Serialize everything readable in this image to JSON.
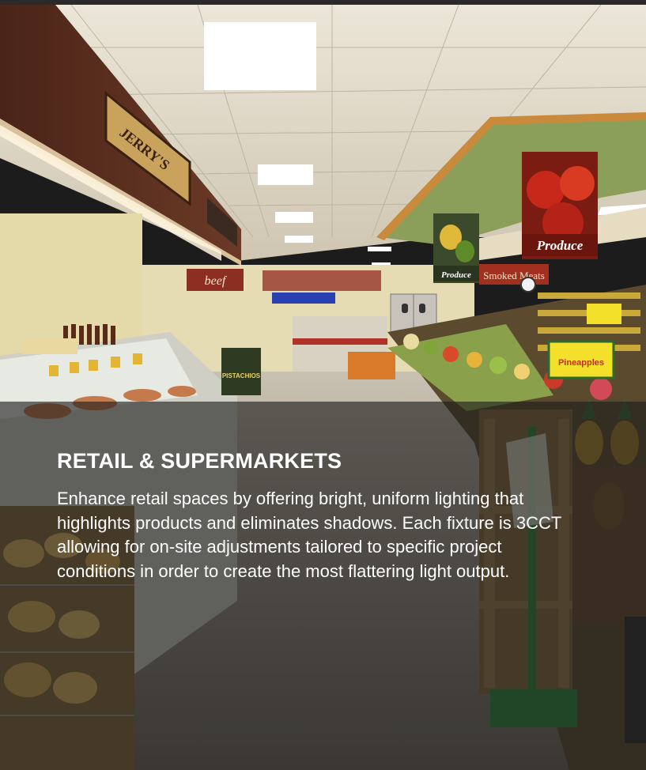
{
  "card": {
    "title": "RETAIL & SUPERMARKETS",
    "description": "Enhance retail spaces by offering bright, uniform lighting that highlights products and eliminates shadows. Each fixture is 3CCT allowing for on-site adjustments tailored to specific project conditions in order to create the most flattering light output."
  },
  "scene_signs": {
    "deli": "JERRY'S",
    "beef": "beef",
    "produce_banner_1": "Produce",
    "produce_banner_2": "Produce",
    "smoked_meats": "Smoked Meats",
    "pineapples": "Pineapples",
    "pistachios": "PISTACHIOS"
  },
  "colors": {
    "ceiling": "#d8d2c4",
    "wall_wood": "#5a2f1f",
    "wall_green": "#8fa65a",
    "floor": "#9a9285",
    "overlay": "#1c1c1c",
    "text": "#ffffff"
  }
}
